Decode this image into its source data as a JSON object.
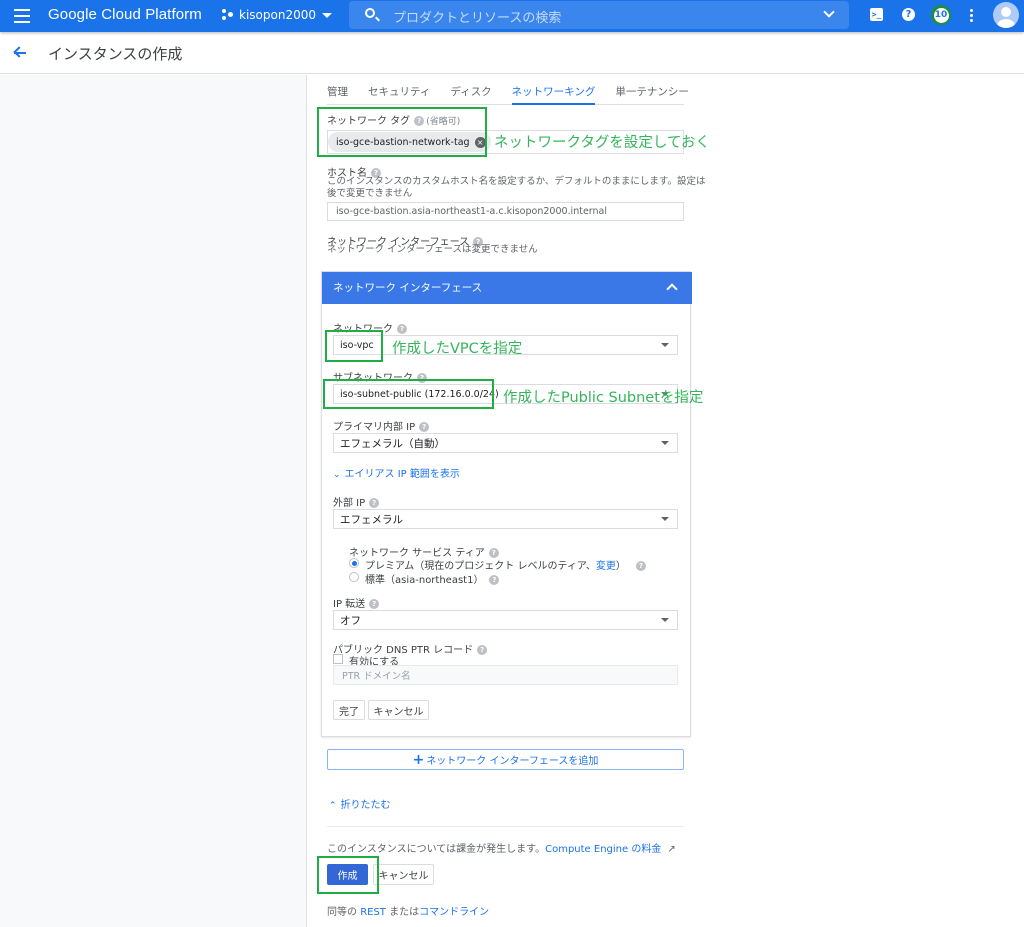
{
  "topbar": {
    "brand": "Google Cloud Platform",
    "project": "kisopon2000",
    "search_placeholder": "プロダクトとリソースの検索",
    "cloudshell_glyph": ">_",
    "help_glyph": "?",
    "notifications_count": "10",
    "icons": [
      "menu-icon",
      "project-icon",
      "search-icon",
      "chevron-down-icon",
      "cloud-shell-icon",
      "help-icon",
      "notifications-icon",
      "more-vert-icon",
      "avatar-icon"
    ]
  },
  "page": {
    "title": "インスタンスの作成"
  },
  "tabs": [
    {
      "label": "管理",
      "active": false
    },
    {
      "label": "セキュリティ",
      "active": false
    },
    {
      "label": "ディスク",
      "active": false
    },
    {
      "label": "ネットワーキング",
      "active": true
    },
    {
      "label": "単一テナンシー",
      "active": false
    }
  ],
  "network_tags": {
    "label": "ネットワーク タグ",
    "optional": "(省略可)",
    "chip": "iso-gce-bastion-network-tag",
    "chip_remove_glyph": "×"
  },
  "hostname": {
    "label": "ホスト名",
    "desc_line1": "このインスタンスのカスタムホスト名を設定するか、デフォルトのままにします。設定は",
    "desc_line2": "後で変更できません",
    "placeholder": "iso-gce-bastion.asia-northeast1-a.c.kisopon2000.internal"
  },
  "network_interfaces": {
    "label": "ネットワーク インターフェース",
    "desc": "ネットワーク インターフェースは変更できません"
  },
  "panel": {
    "title": "ネットワーク インターフェース",
    "network": {
      "label": "ネットワーク",
      "value": "iso-vpc"
    },
    "subnetwork": {
      "label": "サブネットワーク",
      "value": "iso-subnet-public (172.16.0.0/24)"
    },
    "primary_ip": {
      "label": "プライマリ内部 IP",
      "value": "エフェメラル（自動）"
    },
    "alias_link": "エイリアス IP 範囲を表示",
    "external_ip": {
      "label": "外部 IP",
      "value": "エフェメラル"
    },
    "service_tier": {
      "label": "ネットワーク サービス ティア",
      "options": [
        {
          "label": "プレミアム（現在のプロジェクト レベルのティア、",
          "link": "変更",
          "suffix": "）",
          "selected": true
        },
        {
          "label": "標準（asia-northeast1）",
          "selected": false
        }
      ]
    },
    "ip_forwarding": {
      "label": "IP 転送",
      "value": "オフ"
    },
    "dns_ptr": {
      "label": "パブリック DNS PTR レコード",
      "checkbox_label": "有効にする",
      "checked": false,
      "placeholder": "PTR ドメイン名"
    },
    "done_label": "完了",
    "cancel_label": "キャンセル"
  },
  "add_interface_label": "ネットワーク インターフェースを追加",
  "collapse_label": "折りたたむ",
  "billing": {
    "text": "このインスタンスについては課金が発生します。",
    "link": "Compute Engine の料金"
  },
  "actions": {
    "create_label": "作成",
    "cancel_label": "キャンセル"
  },
  "equivalent": {
    "prefix": "同等の",
    "rest": "REST",
    "middle": "または",
    "cmdline": "コマンドライン"
  },
  "annotations": {
    "tag_note": "ネットワークタグを設定しておく",
    "vpc_note": "作成したVPCを指定",
    "subnet_note": "作成したPublic Subnetを指定",
    "highlight_color": "#1fad45",
    "note_color": "#34b55a"
  },
  "colors": {
    "topbar": "#1a73e8",
    "accent": "#1a73e8",
    "panel_header": "#3b78e7",
    "primary_button": "#3367d6"
  }
}
